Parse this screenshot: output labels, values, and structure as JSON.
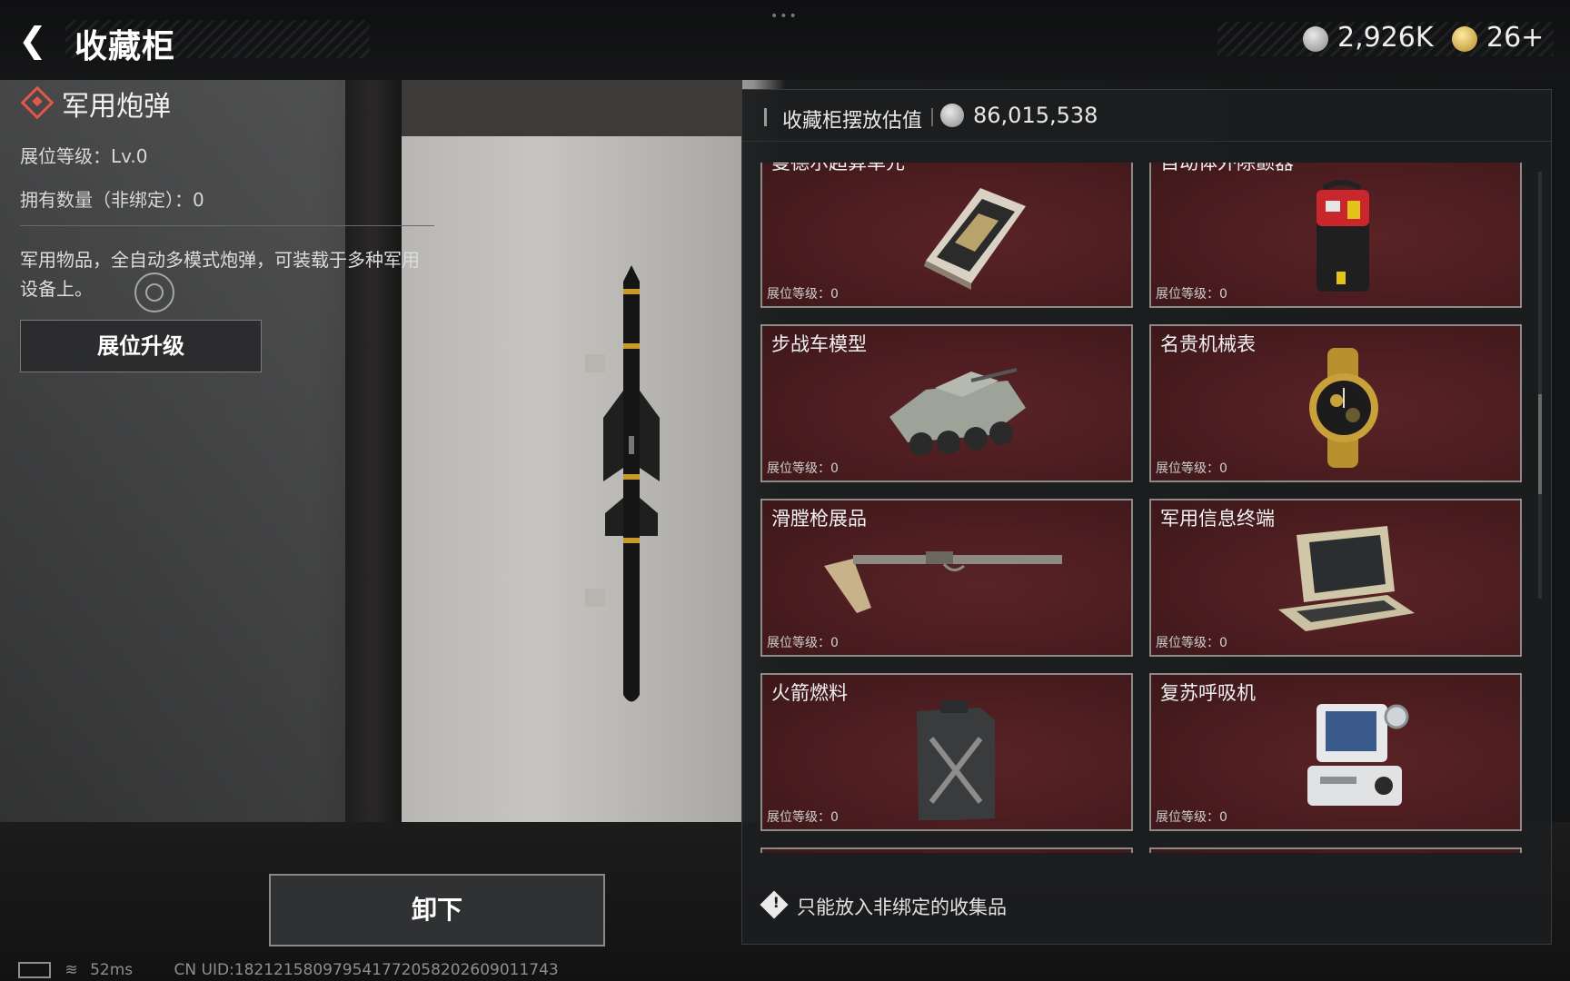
{
  "header": {
    "title": "收藏柜",
    "silver_amount": "2,926K",
    "gold_amount": "26+"
  },
  "item": {
    "name": "军用炮弹",
    "level_line": "展位等级：Lv.0",
    "owned_line": "拥有数量（非绑定）：0",
    "description": "军用物品，全自动多模式炮弹，可装载于多种军用设备上。",
    "upgrade_button": "展位升级",
    "unload_button": "卸下"
  },
  "panel": {
    "header_label": "收藏柜摆放估值",
    "header_value": "86,015,538",
    "footer_note": "只能放入非绑定的收集品",
    "cards": [
      {
        "name": "曼德尔超算单元",
        "level": "展位等级：0",
        "icon": "compute-unit-icon"
      },
      {
        "name": "自动体外除颤器",
        "level": "展位等级：0",
        "icon": "defibrillator-icon"
      },
      {
        "name": "步战车模型",
        "level": "展位等级：0",
        "icon": "ifv-model-icon"
      },
      {
        "name": "名贵机械表",
        "level": "展位等级：0",
        "icon": "watch-icon"
      },
      {
        "name": "滑膛枪展品",
        "level": "展位等级：0",
        "icon": "musket-icon"
      },
      {
        "name": "军用信息终端",
        "level": "展位等级：0",
        "icon": "terminal-case-icon"
      },
      {
        "name": "火箭燃料",
        "level": "展位等级：0",
        "icon": "fuel-can-icon"
      },
      {
        "name": "复苏呼吸机",
        "level": "展位等级：0",
        "icon": "ventilator-icon"
      }
    ]
  },
  "status": {
    "ping": "52ms",
    "uid": "CN UID:18212158097954177205820260901174​3"
  },
  "colors": {
    "accent_red": "#e3564a",
    "card_bg": "#4a1c1f"
  }
}
